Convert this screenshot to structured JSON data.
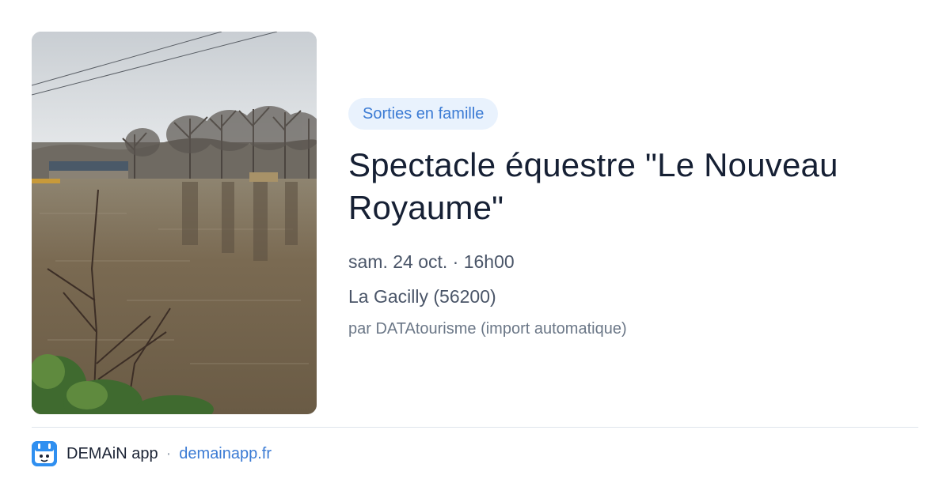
{
  "event": {
    "category": "Sorties en famille",
    "title": "Spectacle équestre \"Le Nouveau Royaume\"",
    "datetime": "sam. 24 oct. · 16h00",
    "location": "La Gacilly (56200)",
    "organizer": "par DATAtourisme (import automatique)",
    "image_icon": "flooded-field-photo"
  },
  "footer": {
    "app_name": "DEMAiN app",
    "separator": "·",
    "domain": "demainapp.fr",
    "app_icon": "demain-app-icon"
  },
  "colors": {
    "accent": "#3b7bd4",
    "badge_bg": "#e9f2fd",
    "title": "#162034",
    "muted": "#6b7787",
    "app_icon_bg": "#2f8ff0"
  }
}
